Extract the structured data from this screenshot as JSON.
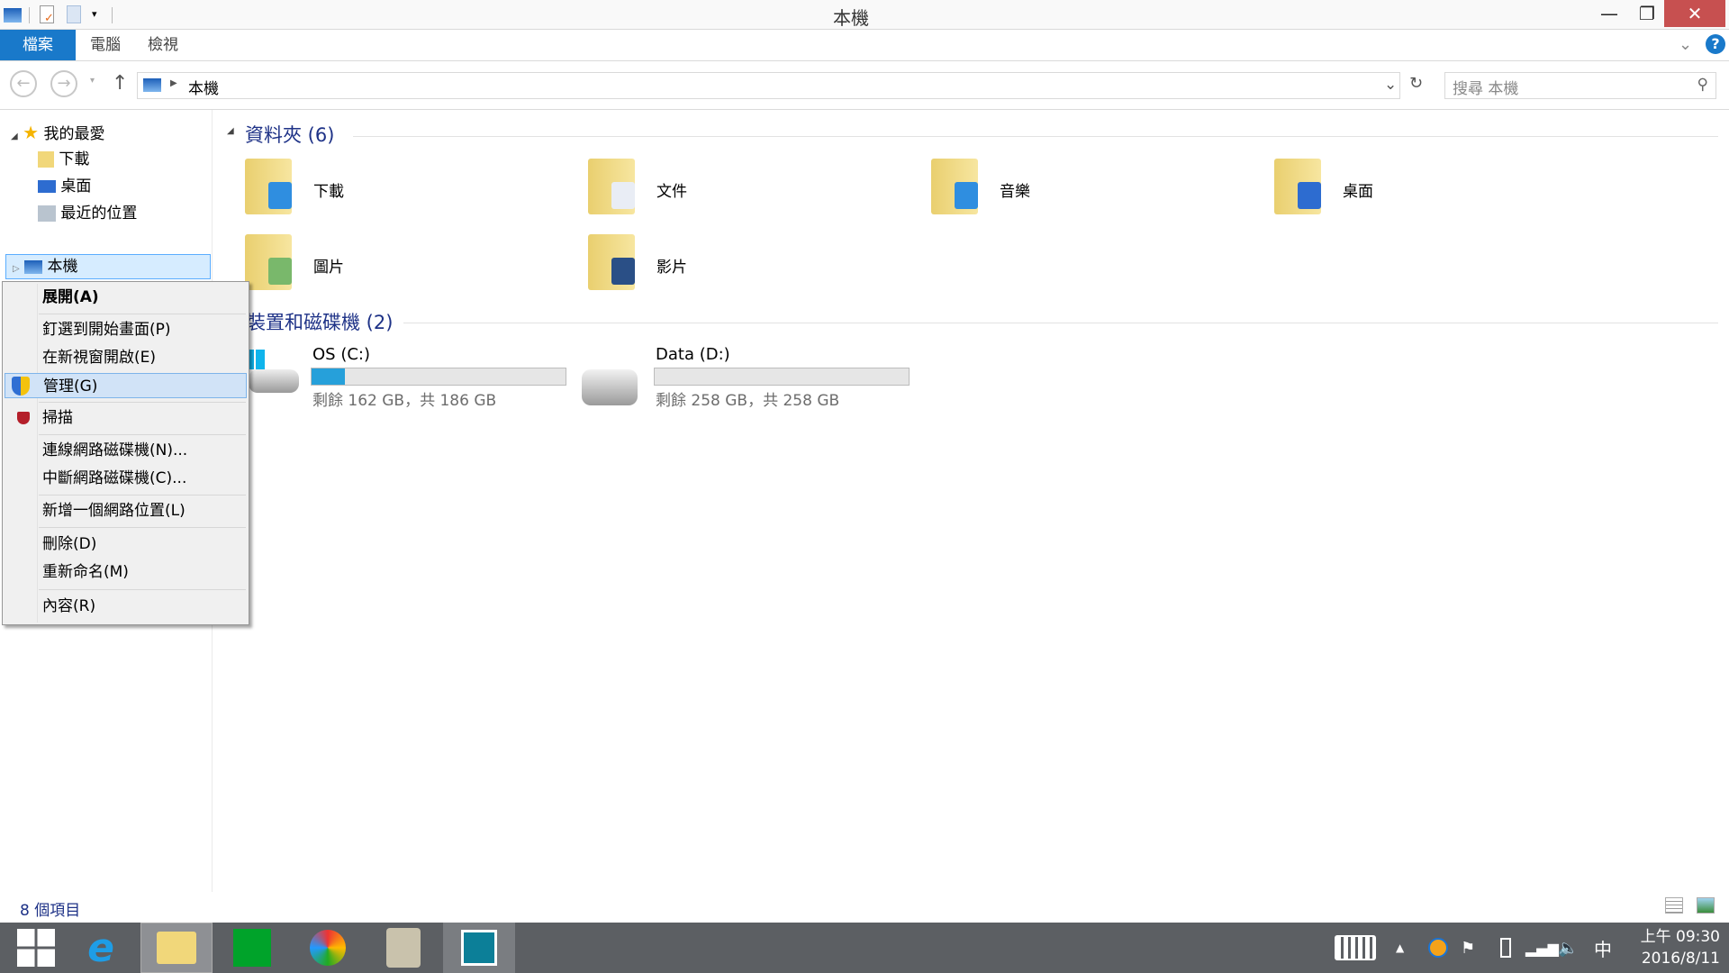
{
  "window": {
    "title": "本機"
  },
  "ribbon": {
    "tabs": [
      {
        "label": "檔案"
      },
      {
        "label": "電腦"
      },
      {
        "label": "檢視"
      }
    ]
  },
  "address": {
    "path": "本機",
    "search_placeholder": "搜尋 本機"
  },
  "sidebar": {
    "favorites_label": "我的最愛",
    "favorites": [
      {
        "label": "下載",
        "icon": "downloads-icon"
      },
      {
        "label": "桌面",
        "icon": "desktop-icon"
      },
      {
        "label": "最近的位置",
        "icon": "recent-places-icon"
      }
    ],
    "this_pc_label": "本機"
  },
  "context_menu": {
    "items": [
      {
        "label": "展開(A)",
        "bold": true
      },
      {
        "label": "釘選到開始畫面(P)"
      },
      {
        "label": "在新視窗開啟(E)"
      },
      {
        "label": "管理(G)",
        "icon": "uac-shield-icon",
        "highlighted": true
      },
      {
        "label": "掃描",
        "icon": "mcafee-icon"
      },
      {
        "label": "連線網路磁碟機(N)..."
      },
      {
        "label": "中斷網路磁碟機(C)..."
      },
      {
        "label": "新增一個網路位置(L)"
      },
      {
        "label": "刪除(D)"
      },
      {
        "label": "重新命名(M)"
      },
      {
        "label": "內容(R)"
      }
    ]
  },
  "content": {
    "folders_header": "資料夾 (6)",
    "folders": [
      {
        "label": "下載"
      },
      {
        "label": "文件"
      },
      {
        "label": "音樂"
      },
      {
        "label": "桌面"
      },
      {
        "label": "圖片"
      },
      {
        "label": "影片"
      }
    ],
    "drives_header": "裝置和磁碟機 (2)",
    "drives": [
      {
        "name": "OS (C:)",
        "free_text": "剩餘 162 GB，共 186 GB",
        "used_fraction": 0.13
      },
      {
        "name": "Data (D:)",
        "free_text": "剩餘 258 GB，共 258 GB",
        "used_fraction": 0.0
      }
    ]
  },
  "status": {
    "item_count": "8 個項目"
  },
  "taskbar": {
    "apps": [
      "start",
      "internet-explorer",
      "file-explorer",
      "store",
      "media-app",
      "maps-app",
      "photos-app"
    ],
    "clock_time": "上午 09:30",
    "clock_date": "2016/8/11",
    "ime": "中"
  },
  "colors": {
    "accent": "#1979ca",
    "close": "#c75050",
    "drive_fill": "#26a0da",
    "section_header": "#1e3287"
  }
}
